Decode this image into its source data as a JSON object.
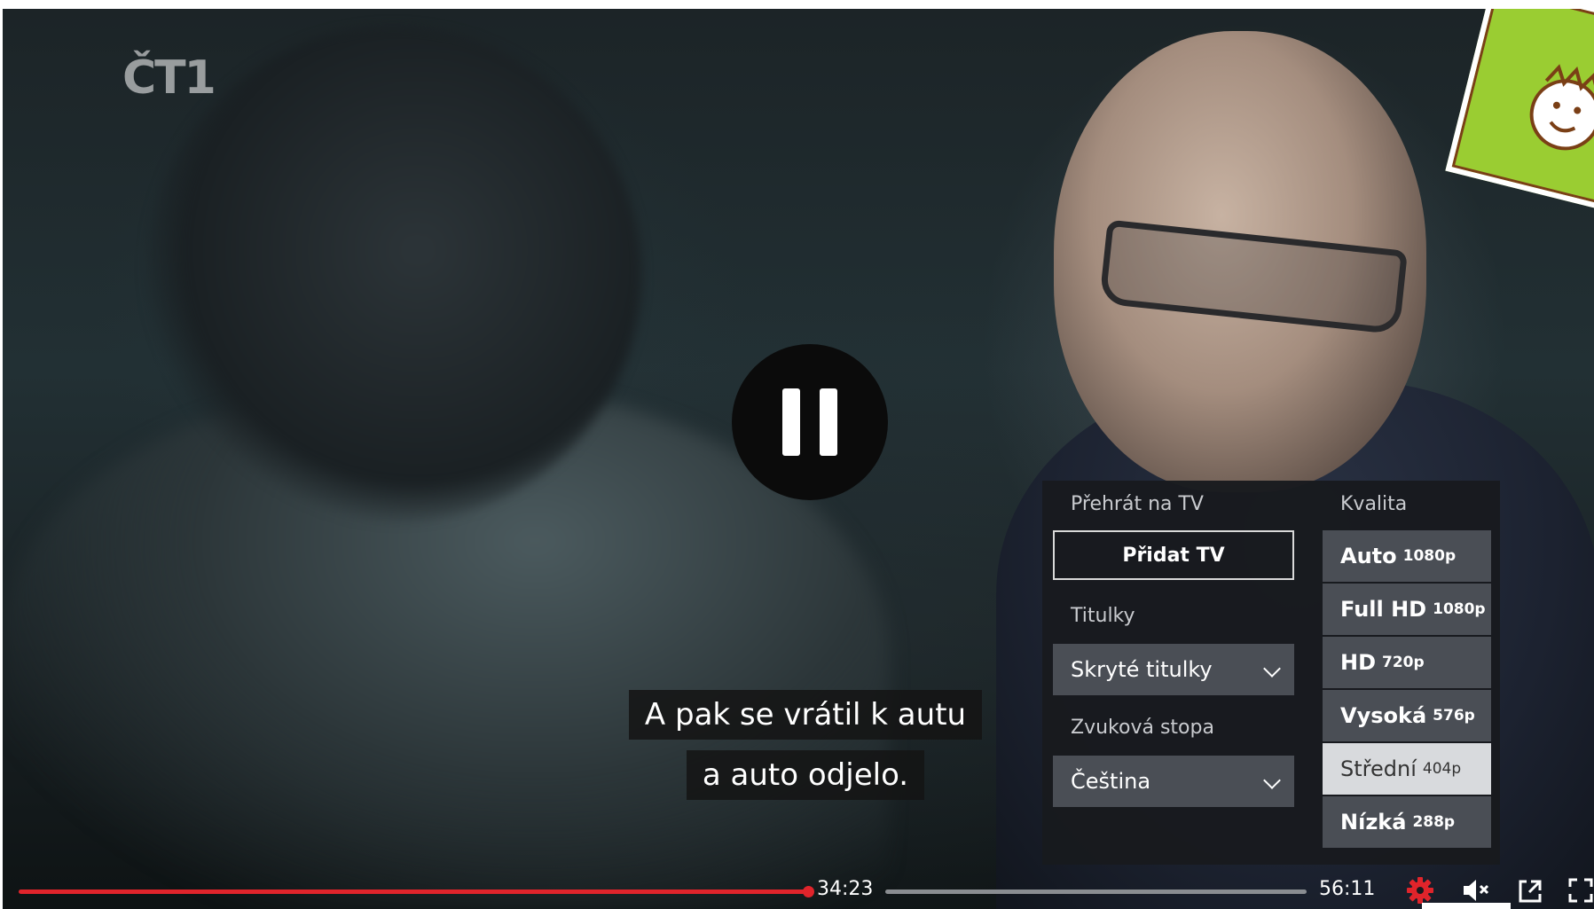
{
  "player": {
    "channel_logo": "ČT1",
    "subtitles": [
      "A pak se vrátil k autu",
      "a auto odjelo."
    ],
    "current_time": "34:23",
    "total_time": "56:11",
    "progress": 0.612
  },
  "settings": {
    "cast_label": "Přehrát na TV",
    "add_tv_label": "Přidat TV",
    "subtitles_label": "Titulky",
    "subtitles_value": "Skryté titulky",
    "audio_label": "Zvuková stopa",
    "audio_value": "Čeština",
    "quality_label": "Kvalita",
    "quality_options": [
      {
        "name": "Auto",
        "res": "1080p"
      },
      {
        "name": "Full HD",
        "res": "1080p"
      },
      {
        "name": "HD",
        "res": "720p"
      },
      {
        "name": "Vysoká",
        "res": "576p"
      },
      {
        "name": "Střední",
        "res": "404p"
      },
      {
        "name": "Nízká",
        "res": "288p"
      }
    ],
    "quality_selected": "Střední"
  },
  "colors": {
    "accent": "#e0242b",
    "panel": "#181a1e",
    "option": "#4a4e55",
    "option_selected": "#d8dadd"
  },
  "icons": [
    "pause-icon",
    "settings-gear-icon",
    "mute-icon",
    "popout-icon",
    "fullscreen-icon"
  ]
}
